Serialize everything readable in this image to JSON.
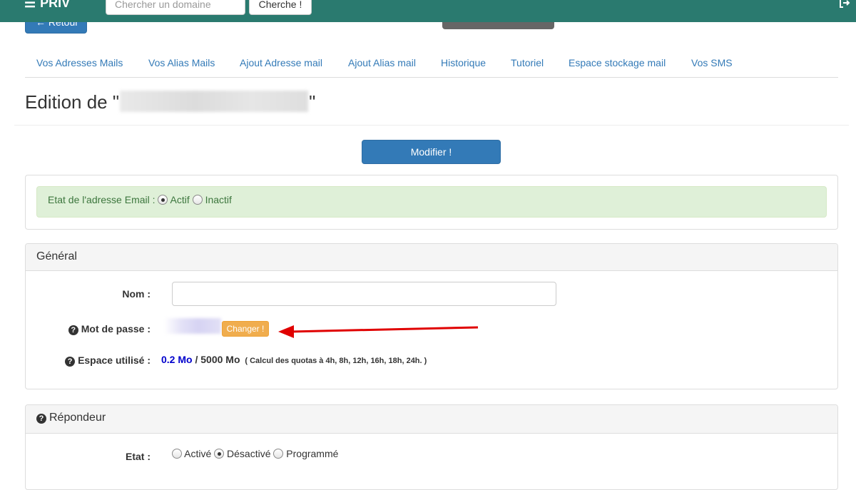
{
  "colors": {
    "topbar": "#2a7a6f",
    "primary": "#337ab7",
    "warning": "#f0ad4e",
    "success_bg": "#dff0d8",
    "success_text": "#3c763d",
    "used_value": "#0000cc",
    "annotation_arrow": "#e00000"
  },
  "topbar": {
    "brand": "PRIV",
    "menu_icon": "bars-icon",
    "search_placeholder": "Chercher un domaine",
    "search_button": "Cherche !",
    "logout_icon": "sign-out-icon"
  },
  "back_button": {
    "label": "Retour",
    "icon": "arrow-left-icon"
  },
  "tabs": [
    {
      "label": "Vos Adresses Mails"
    },
    {
      "label": "Vos Alias Mails"
    },
    {
      "label": "Ajout Adresse mail"
    },
    {
      "label": "Ajout Alias mail"
    },
    {
      "label": "Historique"
    },
    {
      "label": "Tutoriel"
    },
    {
      "label": "Espace stockage mail"
    },
    {
      "label": "Vos SMS"
    }
  ],
  "edit": {
    "title_prefix": "Edition de \"",
    "title_suffix": "\""
  },
  "modify_button": "Modifier !",
  "status": {
    "label": "Etat de l'adresse Email :",
    "options": [
      "Actif",
      "Inactif"
    ],
    "selected": "Actif"
  },
  "general": {
    "heading": "Général",
    "name_label": "Nom :",
    "name_value": "",
    "password_label": "Mot de passe :",
    "change_button": "Changer !",
    "space_label": "Espace utilisé :",
    "space_used": "0.2 Mo",
    "space_sep": "/",
    "space_total": "5000 Mo",
    "quota_note": "( Calcul des quotas à 4h, 8h, 12h, 16h, 18h, 24h. )"
  },
  "responder": {
    "heading": "Répondeur",
    "state_label": "Etat :",
    "options": [
      "Activé",
      "Désactivé",
      "Programmé"
    ],
    "selected": "Désactivé"
  }
}
